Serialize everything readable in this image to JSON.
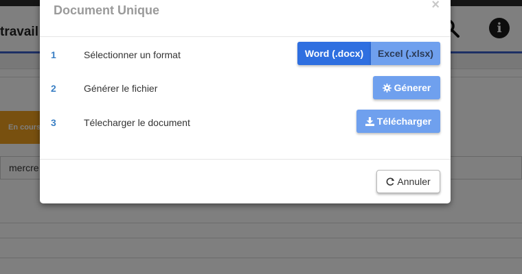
{
  "background": {
    "header_title": "travail",
    "search_icon": "search-icon",
    "info_icon": "info-icon",
    "info_glyph": "i",
    "status_badge": "En cours",
    "date_input_value": "mercre",
    "colors": {
      "topstrip": "#2b2b2b",
      "header_line": "#3a5fc8",
      "badge": "#f0a01e"
    }
  },
  "modal": {
    "title": "Document Unique",
    "close_glyph": "×",
    "steps": [
      {
        "number": "1",
        "label": "Sélectionner un format"
      },
      {
        "number": "2",
        "label": "Générer le fichier"
      },
      {
        "number": "3",
        "label": "Télecharger le document"
      }
    ],
    "format_options": [
      "Word (.docx)",
      "Excel (.xlsx)"
    ],
    "selected_format": "Word (.docx)",
    "generate_label": "Génerer",
    "generate_icon": "gear-icon",
    "download_label": "Télécharger",
    "download_icon": "download-icon",
    "cancel_label": "Annuler",
    "cancel_icon": "refresh-icon",
    "colors": {
      "primary": "#2f6fe0",
      "secondary": "#6fa0ee",
      "step_number": "#3a7fc4"
    }
  }
}
